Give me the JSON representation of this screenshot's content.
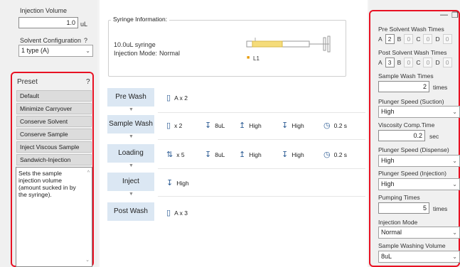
{
  "left": {
    "injection_volume_label": "Injection Volume",
    "injection_volume_value": "1.0",
    "injection_volume_unit": "uL",
    "solvent_config_label": "Solvent Configuration",
    "solvent_config_help": "?",
    "solvent_config_value": "1 type (A)",
    "preset_title": "Preset",
    "preset_help": "?",
    "preset_items": [
      "Default",
      "Minimize Carryover",
      "Conserve Solvent",
      "Conserve Sample",
      "Inject Viscous Sample",
      "Sandwich-Injection"
    ],
    "description": "Sets the sample injection volume (amount sucked in by the syringe)."
  },
  "center": {
    "syringe_info_label": "Syringe Information:",
    "syringe_name": "10.0uL syringe",
    "injection_mode_label": "Injection Mode:",
    "injection_mode_value": "Normal",
    "syringe_marker": "L1",
    "steps": [
      {
        "name": "Pre Wash",
        "params": [
          "A x 2"
        ]
      },
      {
        "name": "Sample Wash",
        "params": [
          "x 2",
          "8uL",
          "High",
          "High",
          "0.2 s"
        ]
      },
      {
        "name": "Loading",
        "params": [
          "x 5",
          "8uL",
          "High",
          "High",
          "0.2 s"
        ]
      },
      {
        "name": "Inject",
        "params": [
          "High"
        ]
      },
      {
        "name": "Post Wash",
        "params": [
          "A x 3"
        ]
      }
    ]
  },
  "right": {
    "pre_solvent_label": "Pre Solvent Wash Times",
    "pre_solvent": {
      "a_label": "A",
      "a": "2",
      "b_label": "B",
      "b": "0",
      "c_label": "C",
      "c": "0",
      "d_label": "D",
      "d": "0"
    },
    "post_solvent_label": "Post Solvent Wash Times",
    "post_solvent": {
      "a_label": "A",
      "a": "3",
      "b_label": "B",
      "b": "0",
      "c_label": "C",
      "c": "0",
      "d_label": "D",
      "d": "0"
    },
    "sample_wash_label": "Sample Wash Times",
    "sample_wash_value": "2",
    "sample_wash_unit": "times",
    "plunger_suction_label": "Plunger Speed (Suction)",
    "plunger_suction_value": "High",
    "viscosity_label": "Viscosity Comp.Time",
    "viscosity_value": "0.2",
    "viscosity_unit": "sec",
    "plunger_dispense_label": "Plunger Speed (Dispense)",
    "plunger_dispense_value": "High",
    "plunger_injection_label": "Plunger Speed (Injection)",
    "plunger_injection_value": "High",
    "pumping_label": "Pumping Times",
    "pumping_value": "5",
    "pumping_unit": "times",
    "injection_mode_label": "Injection Mode",
    "injection_mode_value": "Normal",
    "sample_washing_volume_label": "Sample Washing Volume",
    "sample_washing_volume_value": "8uL"
  },
  "colors": {
    "highlight_frame": "#e81123",
    "step_button": "#dbe7f3",
    "icon": "#2a5a93"
  }
}
